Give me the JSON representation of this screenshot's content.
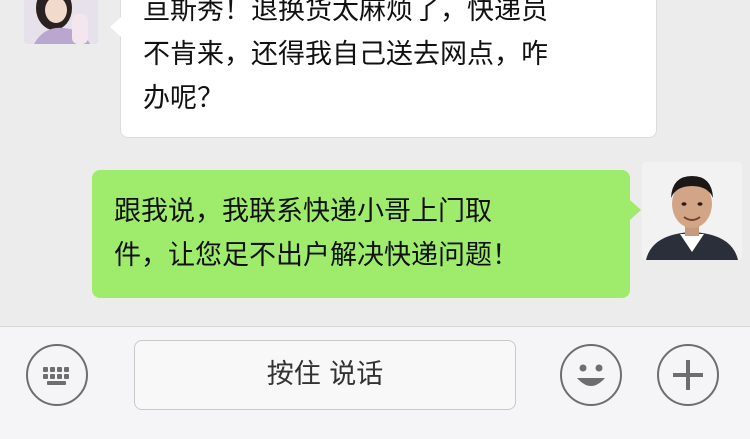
{
  "chat": {
    "messages": [
      {
        "side": "left",
        "lines": [
          "亘斯秀！退换货太麻烦了，快递员",
          "不肯来，还得我自己送去网点，咋",
          "办呢？"
        ],
        "avatar_icon": "female-user-avatar-icon"
      },
      {
        "side": "right",
        "lines": [
          "跟我说，我联系快递小哥上门取",
          "件，让您足不出户解决快递问题！"
        ],
        "avatar_icon": "male-user-avatar-icon"
      }
    ]
  },
  "input_bar": {
    "keyboard_icon": "keyboard-icon",
    "voice_button_label": "按住 说话",
    "emoji_icon": "smiley-face-icon",
    "more_icon": "plus-icon"
  },
  "colors": {
    "chat_background": "#ececec",
    "incoming_bubble": "#ffffff",
    "outgoing_bubble": "#9feb6b",
    "input_bar_background": "#f5f5f7"
  }
}
